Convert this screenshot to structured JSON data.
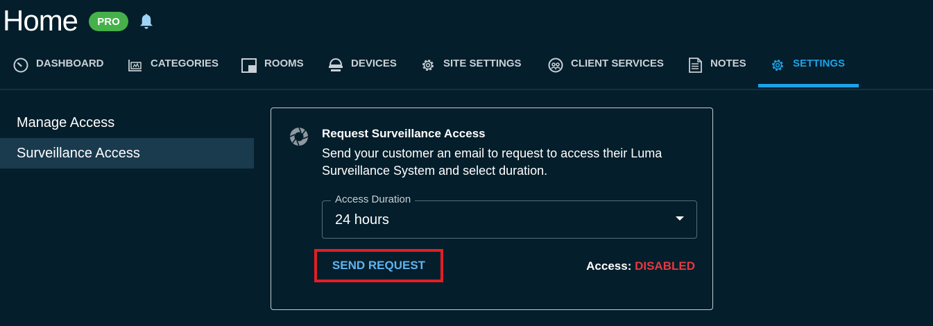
{
  "header": {
    "title": "Home",
    "badge": "PRO",
    "bell_icon": "bell-icon"
  },
  "tabs": [
    {
      "label": "DASHBOARD",
      "icon": "gauge-icon",
      "active": false
    },
    {
      "label": "CATEGORIES",
      "icon": "categories-icon",
      "active": false
    },
    {
      "label": "ROOMS",
      "icon": "rooms-icon",
      "active": false
    },
    {
      "label": "DEVICES",
      "icon": "devices-icon",
      "active": false
    },
    {
      "label": "SITE SETTINGS",
      "icon": "gear-icon",
      "active": false
    },
    {
      "label": "CLIENT SERVICES",
      "icon": "client-services-icon",
      "active": false
    },
    {
      "label": "NOTES",
      "icon": "notes-icon",
      "active": false
    },
    {
      "label": "SETTINGS",
      "icon": "gear-icon",
      "active": true
    }
  ],
  "sidebar": {
    "items": [
      {
        "label": "Manage Access",
        "active": false
      },
      {
        "label": "Surveillance Access",
        "active": true
      }
    ]
  },
  "card": {
    "icon": "camera-shutter-icon",
    "title": "Request Surveillance Access",
    "description": "Send your customer an email to request to access their Luma Surveillance System and select duration.",
    "duration_label": "Access Duration",
    "duration_value": "24 hours",
    "send_button": "SEND REQUEST",
    "access_label": "Access:",
    "access_value": "DISABLED"
  },
  "colors": {
    "background": "#041e2b",
    "accent": "#1ba3e8",
    "pro_badge": "#46b04a",
    "disabled": "#e8383f",
    "highlight_border": "#e31e24"
  }
}
